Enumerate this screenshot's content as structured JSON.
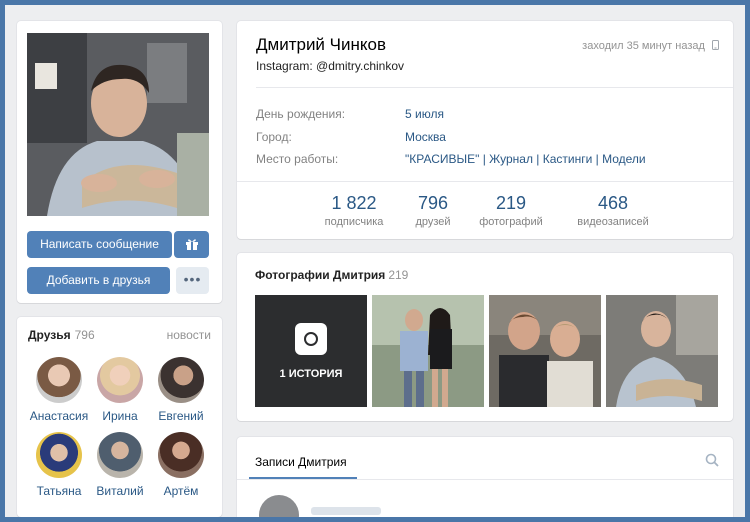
{
  "profile": {
    "name": "Дмитрий Чинков",
    "instagram": "Instagram: @dmitry.chinkov",
    "last_seen": "заходил 35 минут назад",
    "info": [
      {
        "label": "День рождения:",
        "value": "5 июля"
      },
      {
        "label": "Город:",
        "value": "Москва"
      },
      {
        "label": "Место работы:",
        "value": "\"КРАСИВЫЕ\" | Журнал | Кастинги | Модели"
      }
    ],
    "stats": [
      {
        "num": "1 822",
        "label": "подписчика"
      },
      {
        "num": "796",
        "label": "друзей"
      },
      {
        "num": "219",
        "label": "фотографий"
      },
      {
        "num": "468",
        "label": "видеозаписей"
      }
    ]
  },
  "actions": {
    "write_message": "Написать сообщение",
    "add_friend": "Добавить в друзья",
    "more": "•••"
  },
  "friends": {
    "title": "Друзья",
    "count": "796",
    "news": "новости",
    "items": [
      {
        "name": "Анастасия"
      },
      {
        "name": "Ирина"
      },
      {
        "name": "Евгений"
      },
      {
        "name": "Татьяна"
      },
      {
        "name": "Виталий"
      },
      {
        "name": "Артём"
      }
    ]
  },
  "photos": {
    "title": "Фотографии Дмитрия",
    "count": "219",
    "story_label": "1 ИСТОРИЯ"
  },
  "posts": {
    "tab_label": "Записи Дмитрия"
  },
  "colors": {
    "accent": "#5181b8",
    "link": "#2a5885",
    "frame": "#4a76a8"
  }
}
